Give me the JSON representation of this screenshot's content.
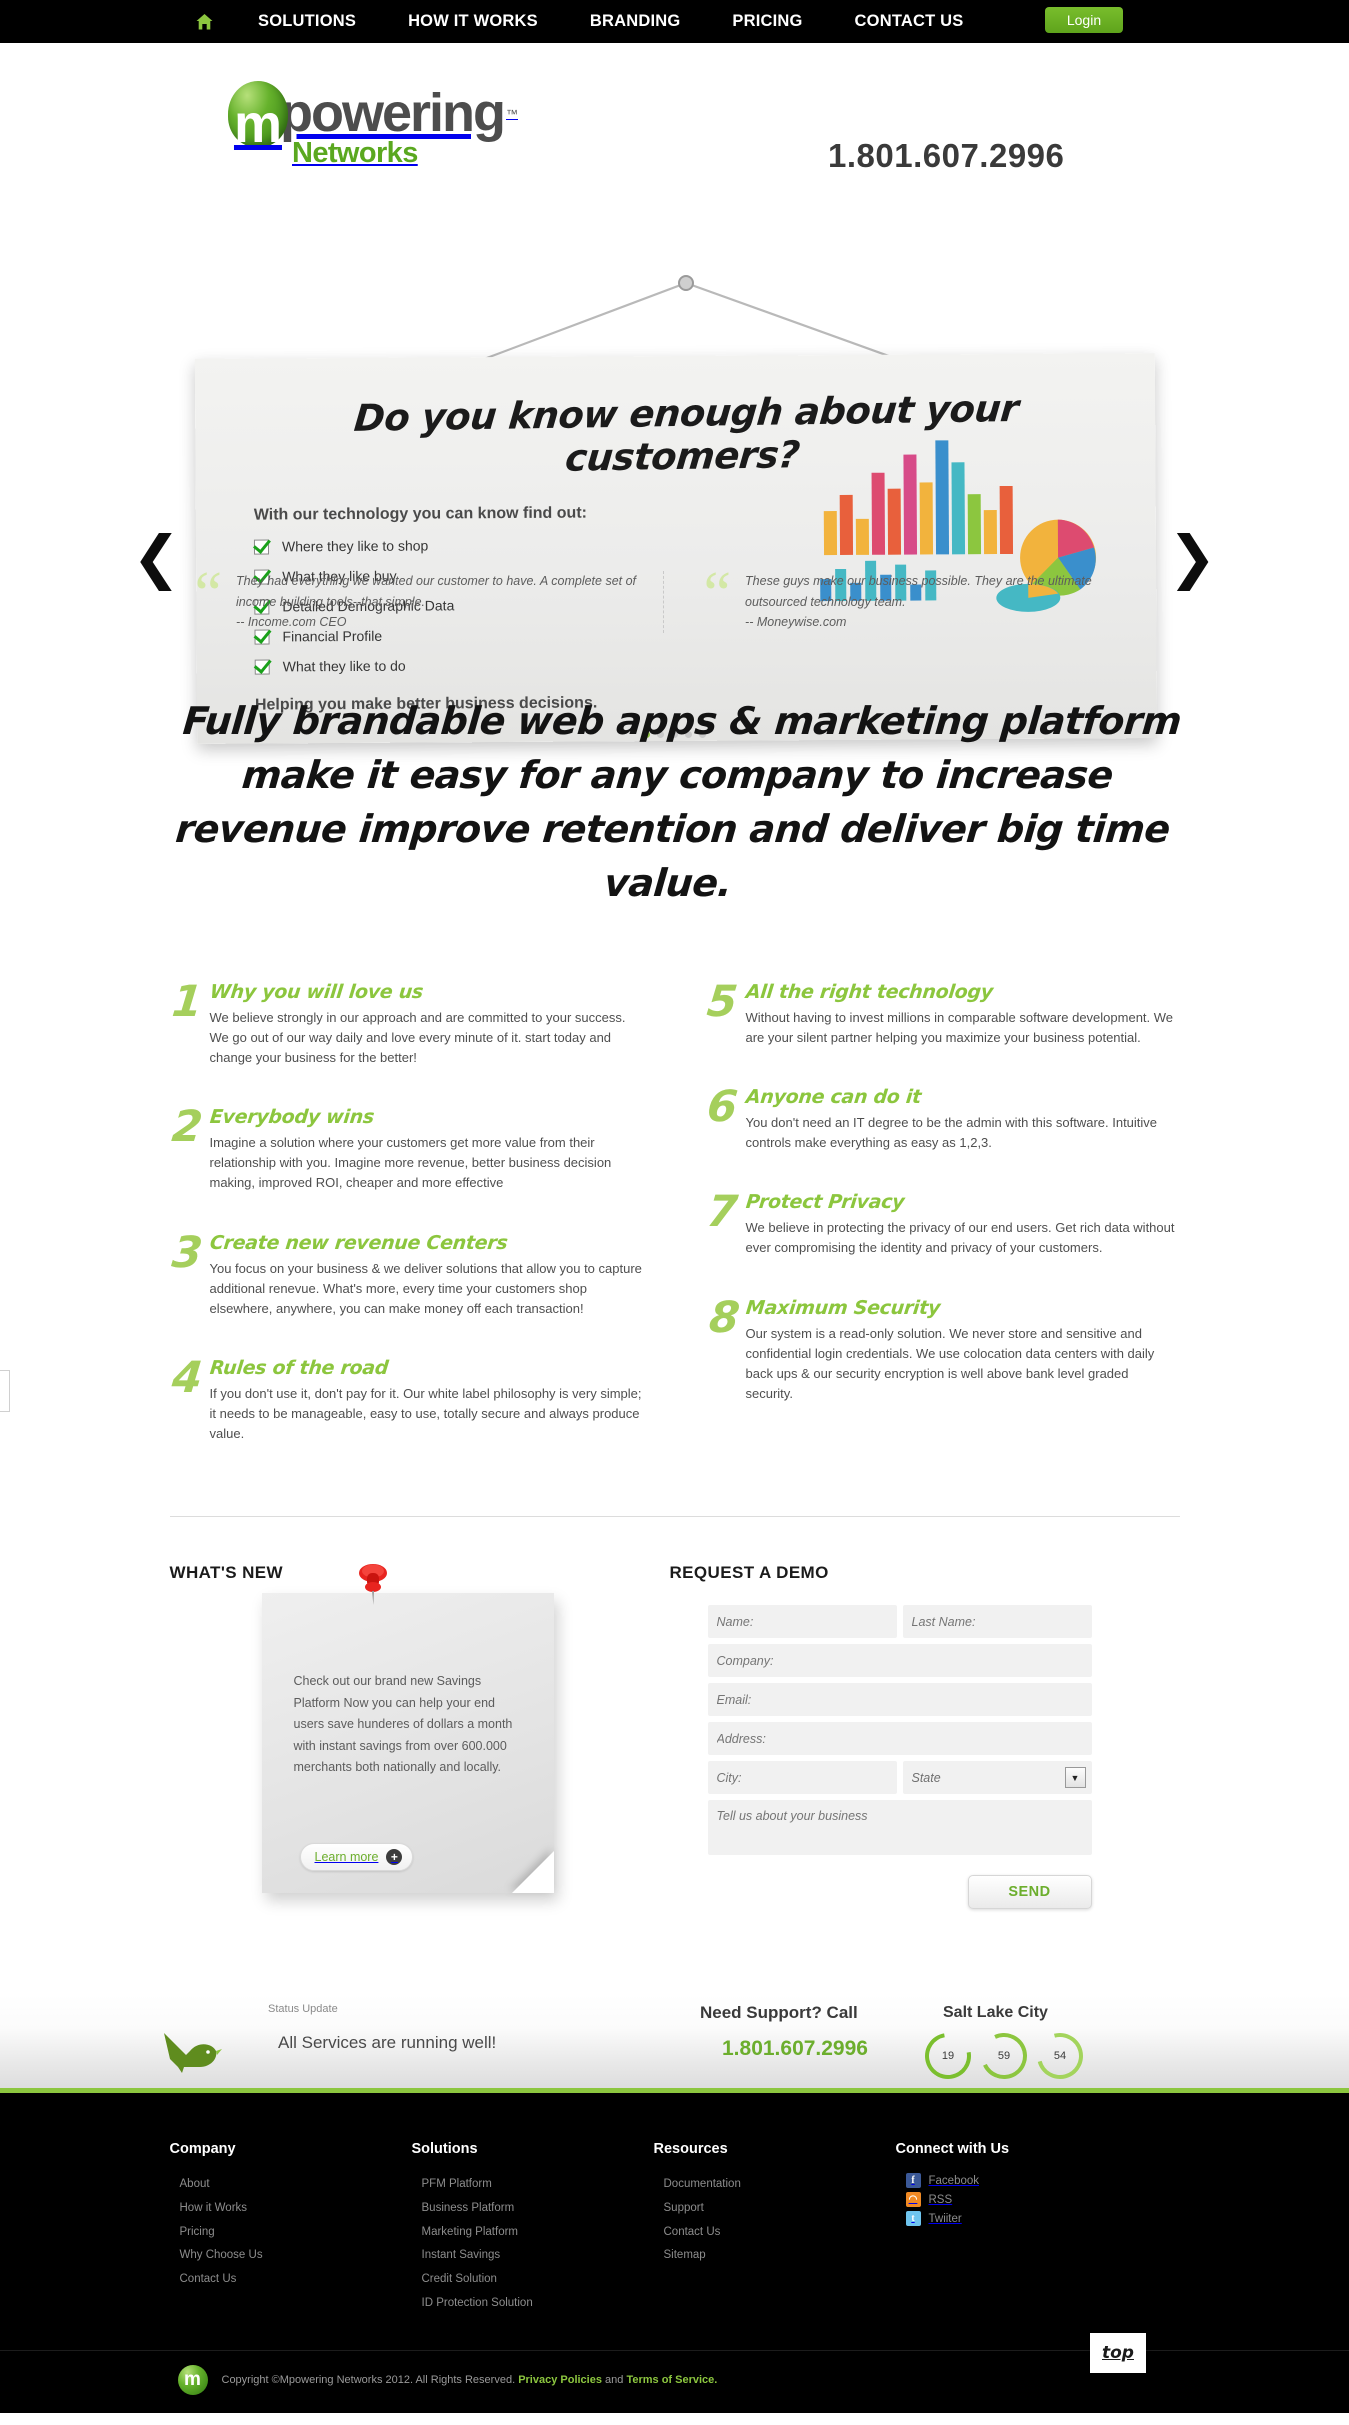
{
  "topnav": {
    "home_icon": "home-icon",
    "items": [
      "SOLUTIONS",
      "HOW IT WORKS",
      "BRANDING",
      "PRICING",
      "CONTACT US"
    ],
    "login_label": "Login"
  },
  "brand": {
    "logo_m": "m",
    "logo_word": "powering",
    "logo_tm": "™",
    "logo_sub": "Networks",
    "phone": "1.801.607.2996"
  },
  "hero": {
    "title": "Do you know enough about your customers?",
    "subtitle": "With our technology you can know find out:",
    "checklist": [
      "Where they like to shop",
      "What they like buy",
      "Detailed Demographic Data",
      "Financial Profile",
      "What they like to do"
    ],
    "footer": "Helping you make better business decisions.",
    "prev_arrow": "❮",
    "next_arrow": "❯",
    "dots": 5,
    "active_dot": 0
  },
  "testimonials": [
    {
      "quote_mark": "“",
      "text": "They had everything we wanted our customer to have. A complete set of income building tools--that simple.",
      "attribution": "-- Income.com CEO"
    },
    {
      "quote_mark": "“",
      "text": "These guys make our business possible. They are the ultimate outsourced technology team.",
      "attribution": "-- Moneywise.com"
    }
  ],
  "headline": "Fully brandable web apps & marketing platform make it easy for any company to increase revenue improve retention and deliver big time value.",
  "features_left": [
    {
      "number": "1",
      "title": "Why you will love us",
      "text": "We believe strongly in our approach and are committed to your success. We go out of our way daily and love every minute of it. start today and change your business for the better!"
    },
    {
      "number": "2",
      "title": "Everybody wins",
      "text": "Imagine a solution where your customers get more value from their relationship with you. Imagine more revenue, better business decision making, improved ROI, cheaper and more effective"
    },
    {
      "number": "3",
      "title": "Create new revenue Centers",
      "text": "You focus on your business & we deliver solutions that allow you to capture additional renevue. What's more, every time your customers shop elsewhere, anywhere, you can make money off each transaction!"
    },
    {
      "number": "4",
      "title": "Rules of the road",
      "text": "If you don't use it, don't pay for it. Our white label philosophy is very simple; it needs to be manageable, easy to use, totally secure and always produce value."
    }
  ],
  "features_right": [
    {
      "number": "5",
      "title": "All the right technology",
      "text": "Without having to invest millions in comparable software development. We are your silent partner helping you maximize your business potential."
    },
    {
      "number": "6",
      "title": "Anyone can do it",
      "text": "You don't need an IT degree to be the admin with this software. Intuitive controls make everything as easy as 1,2,3."
    },
    {
      "number": "7",
      "title": "Protect Privacy",
      "text": "We believe in protecting the privacy of our end users. Get rich data without ever compromising the identity and privacy of your customers."
    },
    {
      "number": "8",
      "title": "Maximum Security",
      "text": "Our system is a read-only solution. We never store and sensitive and confidential login credentials. We use colocation data centers with daily back ups & our security encryption is well above bank level graded security."
    }
  ],
  "whats_new": {
    "heading": "WHAT'S NEW",
    "note_text": "Check out our brand new Savings Platform Now you can help your end users save hunderes of dollars a month with instant savings from over 600.000 merchants both nationally and locally.",
    "learn_more": "Learn more",
    "learn_more_icon": "plus-icon",
    "pin_icon": "pushpin-icon"
  },
  "demo_form": {
    "heading": "REQUEST A DEMO",
    "fields": {
      "first_name": "Name:",
      "last_name": "Last Name:",
      "company": "Company:",
      "email": "Email:",
      "address": "Address:",
      "city": "City:",
      "state": "State",
      "message": "Tell us about your business"
    },
    "state_options": [
      "State"
    ],
    "send_label": "SEND"
  },
  "status": {
    "label": "Status Update",
    "message": "All Services are running well!",
    "bird_icon": "bird-icon",
    "support_label": "Need Support? Call",
    "support_phone": "1.801.607.2996",
    "city": "Salt Lake City",
    "clock": [
      "19",
      "59",
      "54"
    ]
  },
  "footer": {
    "columns": [
      {
        "title": "Company",
        "links": [
          "About",
          "How it Works",
          "Pricing",
          "Why Choose Us",
          "Contact Us"
        ]
      },
      {
        "title": "Solutions",
        "links": [
          "PFM Platform",
          "Business Platform",
          "Marketing Platform",
          "Instant Savings",
          "Credit Solution",
          "ID Protection Solution"
        ]
      },
      {
        "title": "Resources",
        "links": [
          "Documentation",
          "Support",
          "Contact Us",
          "Sitemap"
        ]
      }
    ],
    "social_title": "Connect with Us",
    "social": [
      {
        "name": "Facebook",
        "glyph": "f",
        "color": "#3b5998"
      },
      {
        "name": "RSS",
        "glyph": "◔",
        "color": "#f08a24"
      },
      {
        "name": "Twiiter",
        "glyph": "t",
        "color": "#6fc5ef"
      }
    ],
    "copyright_prefix": "Copyright ©Mpowering Networks 2012. All Rights Reserved.",
    "privacy_label": "Privacy Policies",
    "and_label": "and",
    "terms_label": "Terms of Service.",
    "top_label": "top",
    "logo_letter": "m"
  },
  "colors": {
    "brand_green": "#8cc63f",
    "dark_green": "#6cae2d",
    "black": "#000000",
    "body_text": "#4f4f4f"
  }
}
